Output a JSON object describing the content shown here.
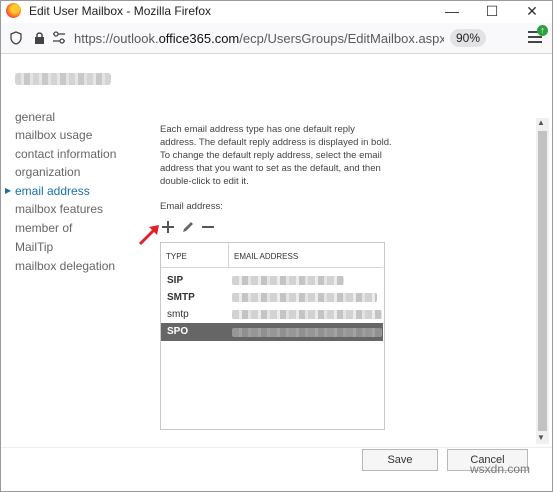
{
  "window": {
    "title": "Edit User Mailbox - Mozilla Firefox",
    "minimize": "—",
    "maximize": "☐",
    "close": "✕"
  },
  "urlbar": {
    "url_prefix": "https://outlook.",
    "url_domain": "office365.com",
    "url_suffix": "/ecp/UsersGroups/EditMailbox.aspx?Activ",
    "zoom": "90%"
  },
  "nav": {
    "items": [
      {
        "label": "general"
      },
      {
        "label": "mailbox usage"
      },
      {
        "label": "contact information"
      },
      {
        "label": "organization"
      },
      {
        "label": "email address",
        "selected": true
      },
      {
        "label": "mailbox features"
      },
      {
        "label": "member of"
      },
      {
        "label": "MailTip"
      },
      {
        "label": "mailbox delegation"
      }
    ]
  },
  "main": {
    "description": "Each email address type has one default reply address. The default reply address is displayed in bold. To change the default reply address, select the email address that you want to set as the default, and then double-click to edit it.",
    "email_label": "Email address:",
    "table": {
      "headers": [
        "TYPE",
        "EMAIL ADDRESS"
      ],
      "rows": [
        {
          "type": "SIP",
          "bold": true
        },
        {
          "type": "SMTP",
          "bold": true
        },
        {
          "type": "smtp",
          "bold": false
        },
        {
          "type": "SPO",
          "bold": true,
          "selected": true
        }
      ]
    }
  },
  "footer": {
    "save_label": "Save",
    "cancel_label": "Cancel",
    "watermark": "wsxdn.com"
  },
  "colors": {
    "accent": "#1a6fb0",
    "selected_row": "#666666",
    "arrow_red": "#e0202a"
  }
}
